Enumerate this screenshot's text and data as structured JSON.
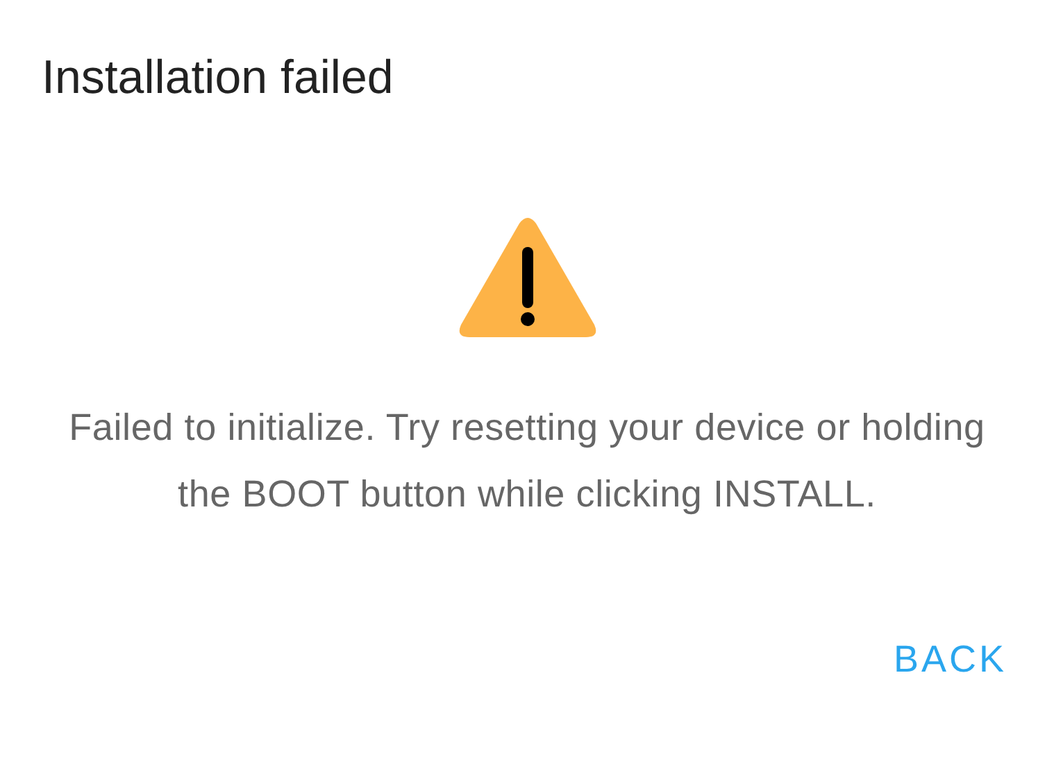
{
  "dialog": {
    "title": "Installation failed",
    "message": "Failed to initialize. Try resetting your device or holding the BOOT button while clicking INSTALL.",
    "buttons": [
      {
        "label": "BACK",
        "kind": "text"
      }
    ]
  }
}
